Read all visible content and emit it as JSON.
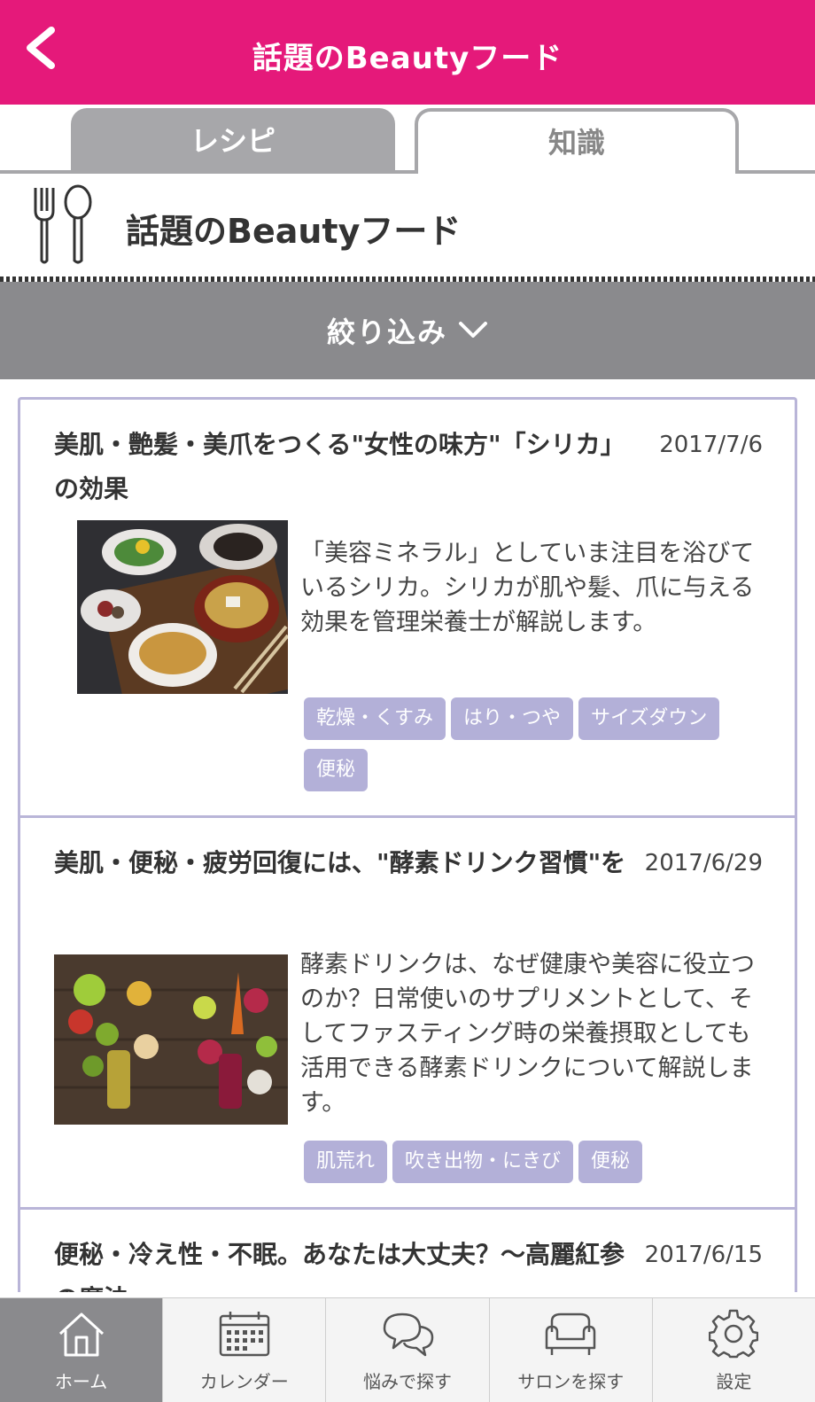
{
  "header": {
    "title": "話題のBeautyフード"
  },
  "tabs": [
    {
      "label": "レシピ",
      "active": false
    },
    {
      "label": "知識",
      "active": true
    }
  ],
  "section": {
    "title": "話題のBeautyフード"
  },
  "filter": {
    "label": "絞り込み"
  },
  "articles": [
    {
      "title": "美肌・艶髪・美爪をつくる\"女性の味方\"「シリカ」の効果",
      "date": "2017/7/6",
      "description": "「美容ミネラル」としていま注目を浴びているシリカ。シリカが肌や髪、爪に与える効果を管理栄養士が解説します。",
      "tags": [
        "乾燥・くすみ",
        "はり・つや",
        "サイズダウン",
        "便秘"
      ]
    },
    {
      "title": "美肌・便秘・疲労回復には、\"酵素ドリンク習慣\"を",
      "date": "2017/6/29",
      "description": "酵素ドリンクは、なぜ健康や美容に役立つのか？日常使いのサプリメントとして、そしてファスティング時の栄養摂取としても活用できる酵素ドリンクについて解説します。",
      "tags": [
        "肌荒れ",
        "吹き出物・にきび",
        "便秘"
      ]
    },
    {
      "title": "便秘・冷え性・不眠。あなたは大丈夫？〜高麗紅参の魔法",
      "date": "2017/6/15"
    }
  ],
  "bottom_nav": [
    {
      "label": "ホーム",
      "icon": "home-icon",
      "active": true
    },
    {
      "label": "カレンダー",
      "icon": "calendar-icon",
      "active": false
    },
    {
      "label": "悩みで探す",
      "icon": "chat-bubbles-icon",
      "active": false
    },
    {
      "label": "サロンを探す",
      "icon": "sofa-icon",
      "active": false
    },
    {
      "label": "設定",
      "icon": "gear-icon",
      "active": false
    }
  ],
  "colors": {
    "header": "#e5197a",
    "tab_inactive": "#a7a7aa",
    "filter_bar": "#8a8a8d",
    "tag": "#b3b0d8",
    "card_border": "#b9b5d8"
  }
}
